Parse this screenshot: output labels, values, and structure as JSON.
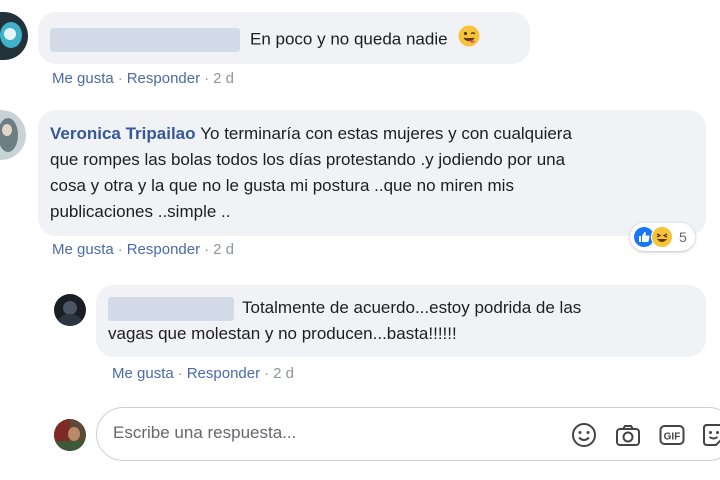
{
  "comments": [
    {
      "author": "",
      "text": "En poco y no queda nadie",
      "emoji": "winking-tongue-emoji",
      "like_label": "Me gusta",
      "reply_label": "Responder",
      "time": "2 d"
    },
    {
      "author": "Veronica Tripailao",
      "lines": [
        "Yo terminaría con estas mujeres y con cualquiera",
        "que rompes las bolas todos los días protestando .y jodiendo por una",
        "cosa y otra y la que no le gusta mi postura ..que no miren mis",
        "publicaciones ..simple .."
      ],
      "reactions": {
        "icons": [
          "like-reaction",
          "haha-reaction"
        ],
        "count": "5"
      },
      "like_label": "Me gusta",
      "reply_label": "Responder",
      "time": "2 d"
    }
  ],
  "reply": {
    "lines": [
      "Totalmente de acuerdo...estoy podrida de las",
      "vagas que molestan y no producen...basta!!!!!!"
    ],
    "like_label": "Me gusta",
    "reply_label": "Responder",
    "time": "2 d"
  },
  "composer": {
    "placeholder": "Escribe una respuesta...",
    "icons": [
      "emoji-icon",
      "camera-icon",
      "gif-icon",
      "sticker-icon"
    ]
  },
  "colors": {
    "bubble": "#f0f2f5",
    "author": "#365899",
    "action": "#4b6aa8",
    "like_blue": "#1877f2",
    "haha_yellow": "#f7c33b"
  }
}
